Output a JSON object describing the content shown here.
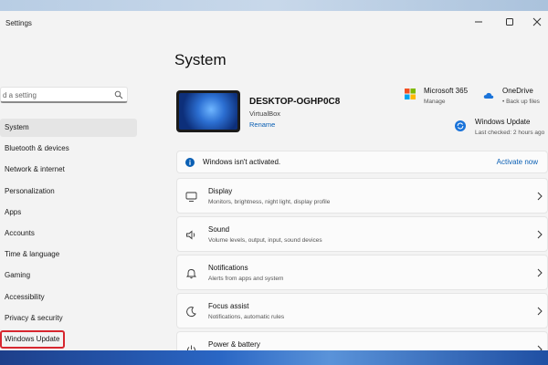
{
  "window": {
    "title": "Settings"
  },
  "sidebar": {
    "search_placeholder": "d a setting",
    "items": [
      {
        "label": "System"
      },
      {
        "label": "Bluetooth & devices"
      },
      {
        "label": "Network & internet"
      },
      {
        "label": "Personalization"
      },
      {
        "label": "Apps"
      },
      {
        "label": "Accounts"
      },
      {
        "label": "Time & language"
      },
      {
        "label": "Gaming"
      },
      {
        "label": "Accessibility"
      },
      {
        "label": "Privacy & security"
      },
      {
        "label": "Windows Update"
      }
    ],
    "active_index": 0,
    "highlighted_index": 10
  },
  "main": {
    "title": "System",
    "device": {
      "name": "DESKTOP-OGHP0C8",
      "model": "VirtualBox",
      "rename_label": "Rename"
    },
    "quick_links": [
      {
        "title": "Microsoft 365",
        "sub": "Manage",
        "icon": "microsoft-logo-icon"
      },
      {
        "title": "OneDrive",
        "sub": "• Back up files",
        "icon": "cloud-icon"
      },
      {
        "title": "Windows Update",
        "sub": "Last checked: 2 hours ago",
        "icon": "update-icon"
      }
    ],
    "activation": {
      "message": "Windows isn't activated.",
      "action": "Activate now"
    },
    "cards": [
      {
        "title": "Display",
        "sub": "Monitors, brightness, night light, display profile",
        "icon": "monitor-icon"
      },
      {
        "title": "Sound",
        "sub": "Volume levels, output, input, sound devices",
        "icon": "speaker-icon"
      },
      {
        "title": "Notifications",
        "sub": "Alerts from apps and system",
        "icon": "bell-icon"
      },
      {
        "title": "Focus assist",
        "sub": "Notifications, automatic rules",
        "icon": "moon-icon"
      },
      {
        "title": "Power & battery",
        "sub": "",
        "icon": "power-icon"
      }
    ]
  },
  "colors": {
    "accent": "#0a5fb4",
    "highlight_border": "#d7262e"
  }
}
